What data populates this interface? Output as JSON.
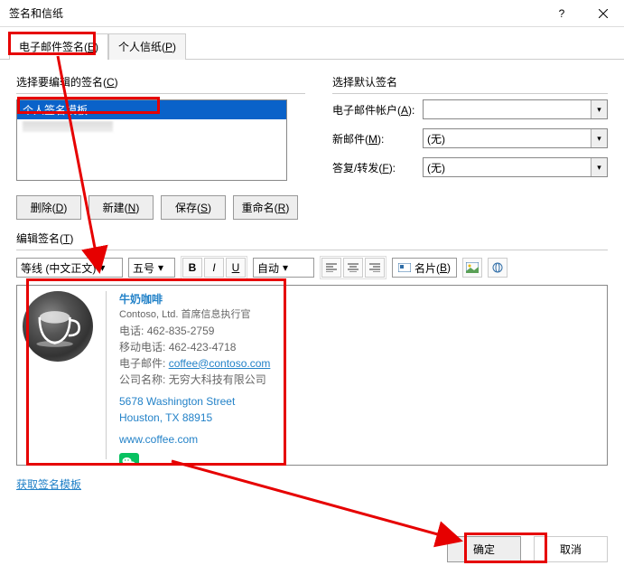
{
  "window": {
    "title": "签名和信纸",
    "help_icon": "?",
    "close_icon": "×"
  },
  "tabs": {
    "email_sig": {
      "label": "电子邮件签名(",
      "accel": "E",
      "tail": ")"
    },
    "stationery": {
      "label": "个人信纸(",
      "accel": "P",
      "tail": ")"
    }
  },
  "left": {
    "select_edit_label": "选择要编辑的签名(",
    "select_edit_accel": "C",
    "select_edit_tail": ")",
    "items": {
      "0": "个人签名模板"
    },
    "delete": {
      "text": "删除(",
      "accel": "D",
      "tail": ")"
    },
    "new": {
      "text": "新建(",
      "accel": "N",
      "tail": ")"
    },
    "save": {
      "text": "保存(",
      "accel": "S",
      "tail": ")"
    },
    "rename": {
      "text": "重命名(",
      "accel": "R",
      "tail": ")"
    }
  },
  "right": {
    "section_label": "选择默认签名",
    "account": {
      "label": "电子邮件帐户(",
      "accel": "A",
      "tail": "):",
      "value": ""
    },
    "new_msg": {
      "label": "新邮件(",
      "accel": "M",
      "tail": "):",
      "value": "(无)"
    },
    "reply": {
      "label": "答复/转发(",
      "accel": "F",
      "tail": "):",
      "value": "(无)"
    }
  },
  "edit_label": {
    "text": "编辑签名(",
    "accel": "T",
    "tail": ")"
  },
  "toolbar": {
    "font": "等线 (中文正文)",
    "size": "五号",
    "bold": "B",
    "italic": "I",
    "underline": "U",
    "color": "自动",
    "card": {
      "text": "名片(",
      "accel": "B",
      "tail": ")"
    }
  },
  "signature": {
    "name": "牛奶咖啡",
    "role_prefix": "Contoso, Ltd. ",
    "role": "首席信息执行官",
    "phone_lbl": "电话:",
    "phone": "462-835-2759",
    "mobile_lbl": "移动电话:",
    "mobile": "462-423-4718",
    "email_lbl": "电子邮件:",
    "email": "coffee@contoso.com",
    "company_lbl": "公司名称:",
    "company": "无穷大科技有限公司",
    "addr1": "5678 Washington Street",
    "addr2": "Houston, TX 88915",
    "url": "www.coffee.com"
  },
  "get_templates": "获取签名模板",
  "footer": {
    "ok": "确定",
    "cancel": "取消"
  }
}
